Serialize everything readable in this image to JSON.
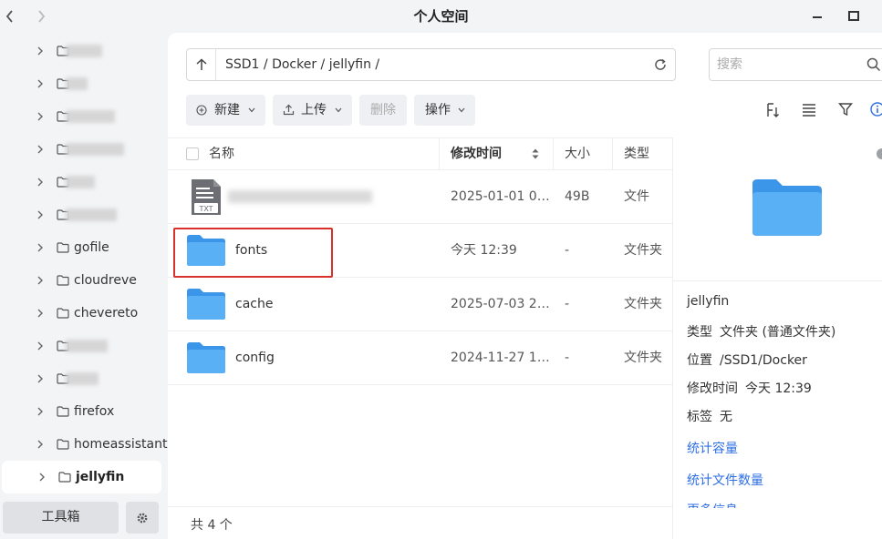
{
  "window": {
    "title": "个人空间"
  },
  "sidebar": {
    "items": [
      {
        "label": ""
      },
      {
        "label": ""
      },
      {
        "label": ""
      },
      {
        "label": ""
      },
      {
        "label": ""
      },
      {
        "label": ""
      },
      {
        "label": "gofile"
      },
      {
        "label": "cloudreve"
      },
      {
        "label": "chevereto"
      },
      {
        "label": ""
      },
      {
        "label": ""
      },
      {
        "label": "firefox"
      },
      {
        "label": "homeassistant"
      },
      {
        "label": "jellyfin"
      }
    ],
    "toolbox_label": "工具箱"
  },
  "pathbar": {
    "path": "SSD1 / Docker / jellyfin /"
  },
  "search": {
    "placeholder": "搜索"
  },
  "toolbar": {
    "new_label": "新建",
    "upload_label": "上传",
    "delete_label": "删除",
    "action_label": "操作"
  },
  "table": {
    "headers": {
      "name": "名称",
      "mtime": "修改时间",
      "size": "大小",
      "type": "类型"
    },
    "rows": [
      {
        "name": "",
        "mtime": "2025-01-01 0…",
        "size": "49B",
        "type": "文件",
        "icon": "txt-file-icon",
        "icon_label": "TXT"
      },
      {
        "name": "fonts",
        "mtime": "今天 12:39",
        "size": "-",
        "type": "文件夹",
        "icon": "folder-icon"
      },
      {
        "name": "cache",
        "mtime": "2025-07-03 2…",
        "size": "-",
        "type": "文件夹",
        "icon": "folder-icon"
      },
      {
        "name": "config",
        "mtime": "2024-11-27 1…",
        "size": "-",
        "type": "文件夹",
        "icon": "folder-icon"
      }
    ]
  },
  "status": {
    "count_text": "共 4 个"
  },
  "details": {
    "name": "jellyfin",
    "type_key": "类型",
    "type_value": "文件夹 (普通文件夹)",
    "location_key": "位置",
    "location_value": "/SSD1/Docker",
    "mtime_key": "修改时间",
    "mtime_value": "今天 12:39",
    "tag_key": "标签",
    "tag_value": "无",
    "link_capacity": "统计容量",
    "link_filecount": "统计文件数量",
    "link_more": "更多信息"
  },
  "colors": {
    "accent": "#2f6fe4",
    "folder": "#4aa3f0",
    "highlight": "#d9302c"
  }
}
